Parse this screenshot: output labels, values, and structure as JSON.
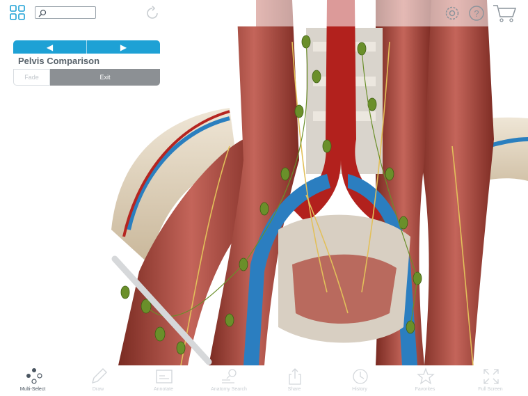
{
  "panel": {
    "prev_icon": "triangle-left",
    "next_icon": "triangle-right",
    "prev_symbol": "◀",
    "next_symbol": "▶",
    "title": "Pelvis Comparison",
    "fade_label": "Fade",
    "exit_label": "Exit"
  },
  "toolbar": {
    "items": [
      {
        "label": "Multi-Select",
        "icon": "multi-select-icon",
        "active": true
      },
      {
        "label": "Draw",
        "icon": "pencil-icon"
      },
      {
        "label": "Annotate",
        "icon": "annotate-icon"
      },
      {
        "label": "Anatomy Search",
        "icon": "anatomy-search-icon"
      },
      {
        "label": "Share",
        "icon": "share-icon"
      },
      {
        "label": "History",
        "icon": "history-icon"
      },
      {
        "label": "Favorites",
        "icon": "star-icon"
      },
      {
        "label": "Full Screen",
        "icon": "full-screen-icon"
      }
    ]
  },
  "colors": {
    "accent": "#1ea1d5",
    "icon_gray": "#8a939b",
    "exit_bg": "#8c9094"
  }
}
